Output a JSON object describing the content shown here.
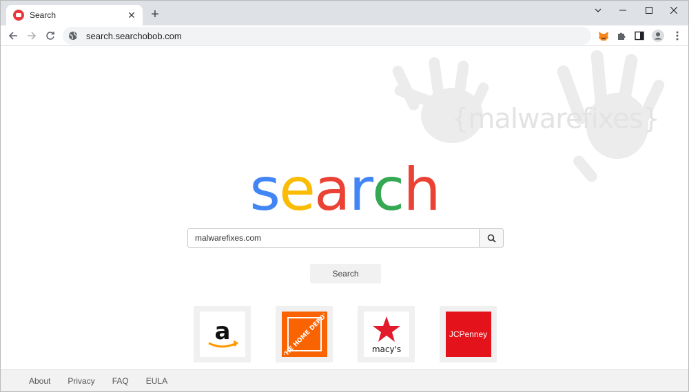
{
  "tab": {
    "title": "Search",
    "close": "✕",
    "new_tab": "+"
  },
  "toolbar": {
    "url": "search.searchobob.com"
  },
  "watermark": {
    "text": "{malwarefixes}"
  },
  "logo": {
    "letters": [
      {
        "char": "s",
        "color": "#4285f4"
      },
      {
        "char": "e",
        "color": "#fbbc05"
      },
      {
        "char": "a",
        "color": "#ea4335"
      },
      {
        "char": "r",
        "color": "#4285f4"
      },
      {
        "char": "c",
        "color": "#34a853"
      },
      {
        "char": "h",
        "color": "#ea4335"
      }
    ]
  },
  "search": {
    "value": "malwarefixes.com",
    "button_label": "Search"
  },
  "tiles": [
    {
      "name": "amazon",
      "label": "a"
    },
    {
      "name": "home-depot",
      "label": "THE HOME DEPOT"
    },
    {
      "name": "macys",
      "label": "macy's"
    },
    {
      "name": "jcpenney",
      "label": "JCPenney"
    }
  ],
  "footer": {
    "links": [
      "About",
      "Privacy",
      "FAQ",
      "EULA"
    ]
  },
  "colors": {
    "tabstrip": "#dee1e6",
    "home_depot": "#f96302",
    "macys": "#e21a2c",
    "jcpenney": "#e4121b"
  }
}
